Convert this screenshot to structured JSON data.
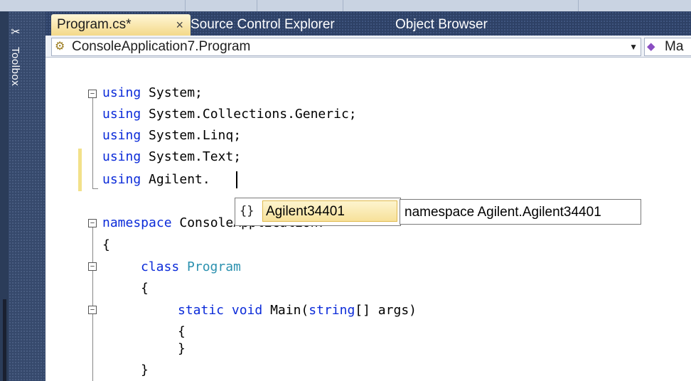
{
  "tabs": [
    {
      "label": "Program.cs*",
      "close": "×"
    },
    {
      "label": "Source Control Explorer"
    },
    {
      "label": "Object Browser"
    }
  ],
  "toolbox": {
    "label": "Toolbox",
    "icon": "toolbox-icon"
  },
  "navigation": {
    "type_combo": {
      "icon": "class-icon",
      "value": "ConsoleApplication7.Program"
    },
    "member_combo": {
      "icon": "method-icon",
      "value": "Ma"
    }
  },
  "code": {
    "line1_kw": "using",
    "line1_rest": " System;",
    "line2_kw": "using",
    "line2_rest": " System.Collections.Generic;",
    "line3_kw": "using",
    "line3_rest": " System.Linq;",
    "line4_kw": "using",
    "line4_rest": " System.Text;",
    "line5_kw": "using",
    "line5_rest": " Agilent.",
    "line7_kw": "namespace",
    "line7_rest": " ConsoleApplication7",
    "line8": "{",
    "line9_kw": "class",
    "line9_type": "Program",
    "line10": "{",
    "line11_kw1": "static",
    "line11_kw2": "void",
    "line11_name": "Main(",
    "line11_kw3": "string",
    "line11_rest": "[] args)",
    "line12": "{",
    "line13": "}",
    "line14": "}"
  },
  "intellisense": {
    "icon": "namespace-icon",
    "icon_glyph": "{}",
    "selected_item": "Agilent34401",
    "tooltip": "namespace Agilent.Agilent34401"
  }
}
